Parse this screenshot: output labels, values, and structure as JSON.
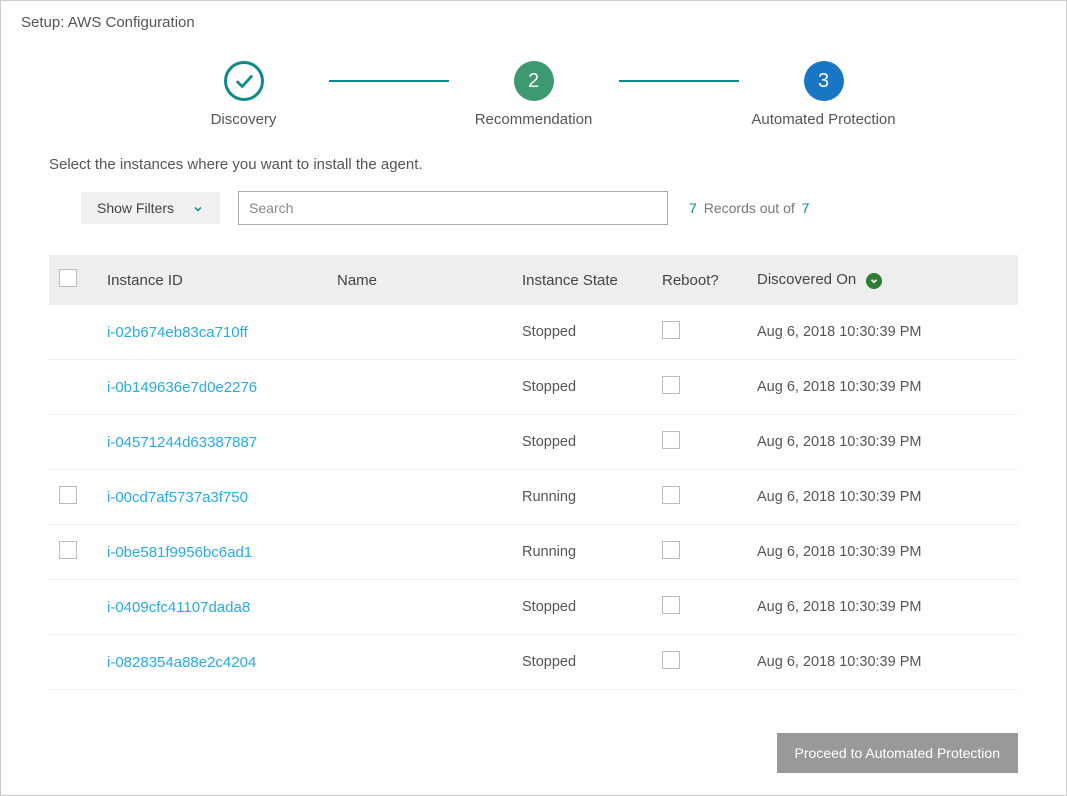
{
  "header": {
    "title": "Setup: AWS Configuration"
  },
  "stepper": {
    "step1": "Discovery",
    "step2_num": "2",
    "step2": "Recommendation",
    "step3_num": "3",
    "step3": "Automated Protection"
  },
  "instructions": "Select the instances where you want to install the agent.",
  "toolbar": {
    "show_filters": "Show Filters",
    "search_placeholder": "Search",
    "count_shown": "7",
    "count_label": "Records out of",
    "count_total": "7"
  },
  "columns": {
    "instance_id": "Instance ID",
    "name": "Name",
    "instance_state": "Instance State",
    "reboot": "Reboot?",
    "discovered_on": "Discovered On"
  },
  "rows": [
    {
      "id": "i-02b674eb83ca710ff",
      "name": "",
      "state": "Stopped",
      "show_row_check": false,
      "discovered": "Aug 6, 2018 10:30:39 PM"
    },
    {
      "id": "i-0b149636e7d0e2276",
      "name": "",
      "state": "Stopped",
      "show_row_check": false,
      "discovered": "Aug 6, 2018 10:30:39 PM"
    },
    {
      "id": "i-04571244d63387887",
      "name": "",
      "state": "Stopped",
      "show_row_check": false,
      "discovered": "Aug 6, 2018 10:30:39 PM"
    },
    {
      "id": "i-00cd7af5737a3f750",
      "name": "",
      "state": "Running",
      "show_row_check": true,
      "discovered": "Aug 6, 2018 10:30:39 PM"
    },
    {
      "id": "i-0be581f9956bc6ad1",
      "name": "",
      "state": "Running",
      "show_row_check": true,
      "discovered": "Aug 6, 2018 10:30:39 PM"
    },
    {
      "id": "i-0409cfc41107dada8",
      "name": "",
      "state": "Stopped",
      "show_row_check": false,
      "discovered": "Aug 6, 2018 10:30:39 PM"
    },
    {
      "id": "i-0828354a88e2c4204",
      "name": "",
      "state": "Stopped",
      "show_row_check": false,
      "discovered": "Aug 6, 2018 10:30:39 PM"
    }
  ],
  "footer": {
    "proceed": "Proceed to Automated Protection"
  }
}
